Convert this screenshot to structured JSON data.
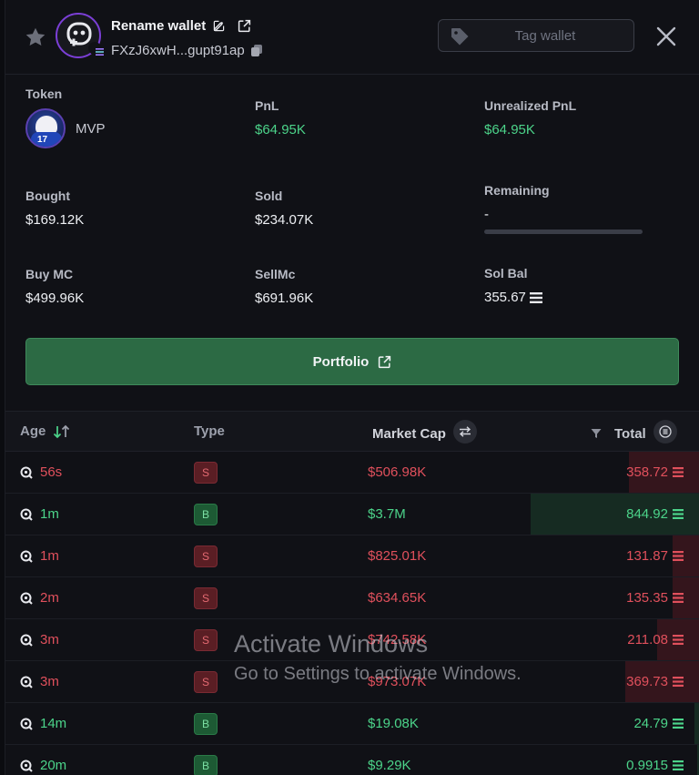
{
  "header": {
    "wallet_name": "Rename wallet",
    "wallet_address": "FXzJ6xwH...gupt91ap",
    "tag_button": "Tag wallet"
  },
  "stats": {
    "token_label": "Token",
    "token_name": "MVP",
    "pnl_label": "PnL",
    "pnl_value": "$64.95K",
    "unrealized_label": "Unrealized PnL",
    "unrealized_value": "$64.95K",
    "bought_label": "Bought",
    "bought_value": "$169.12K",
    "sold_label": "Sold",
    "sold_value": "$234.07K",
    "remaining_label": "Remaining",
    "remaining_value": "-",
    "buymc_label": "Buy MC",
    "buymc_value": "$499.96K",
    "sellmc_label": "SellMc",
    "sellmc_value": "$691.96K",
    "solbal_label": "Sol Bal",
    "solbal_value": "355.67"
  },
  "portfolio_button": "Portfolio",
  "table": {
    "headers": {
      "age": "Age",
      "type": "Type",
      "market_cap": "Market Cap",
      "total": "Total"
    },
    "rows": [
      {
        "age": "56s",
        "type": "S",
        "market_cap": "$506.98K",
        "total": "358.72",
        "fill": 0.42
      },
      {
        "age": "1m",
        "type": "B",
        "market_cap": "$3.7M",
        "total": "844.92",
        "fill": 1.0
      },
      {
        "age": "1m",
        "type": "S",
        "market_cap": "$825.01K",
        "total": "131.87",
        "fill": 0.16
      },
      {
        "age": "2m",
        "type": "S",
        "market_cap": "$634.65K",
        "total": "135.35",
        "fill": 0.16
      },
      {
        "age": "3m",
        "type": "S",
        "market_cap": "$742.58K",
        "total": "211.08",
        "fill": 0.25
      },
      {
        "age": "3m",
        "type": "S",
        "market_cap": "$973.07K",
        "total": "369.73",
        "fill": 0.44
      },
      {
        "age": "14m",
        "type": "B",
        "market_cap": "$19.08K",
        "total": "24.79",
        "fill": 0.03
      },
      {
        "age": "20m",
        "type": "B",
        "market_cap": "$9.29K",
        "total": "0.9915",
        "fill": 0.001
      }
    ]
  },
  "colors": {
    "green": "#4cd48a",
    "red": "#e0505c",
    "accent_purple": "#7b3fd6",
    "portfolio_bg": "#2c6a44"
  },
  "watermark": {
    "line1": "Activate Windows",
    "line2": "Go to Settings to activate Windows."
  }
}
